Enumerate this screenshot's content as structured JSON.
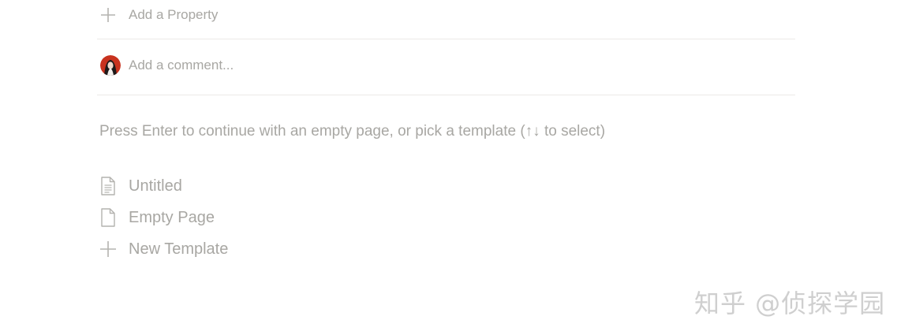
{
  "properties": {
    "add_label": "Add a Property",
    "add_icon": "plus-icon"
  },
  "comment": {
    "placeholder": "Add a comment...",
    "avatar_icon": "user-avatar"
  },
  "hint": "Press Enter to continue with an empty page, or pick a template (↑↓ to select)",
  "templates": [
    {
      "label": "Untitled",
      "icon": "text-page-icon"
    },
    {
      "label": "Empty Page",
      "icon": "empty-page-icon"
    },
    {
      "label": "New Template",
      "icon": "plus-icon"
    }
  ],
  "watermark": "知乎 @侦探学园",
  "colors": {
    "muted_text": "#a8a7a3",
    "divider": "#ebeae8",
    "avatar_red": "#c8321e"
  }
}
